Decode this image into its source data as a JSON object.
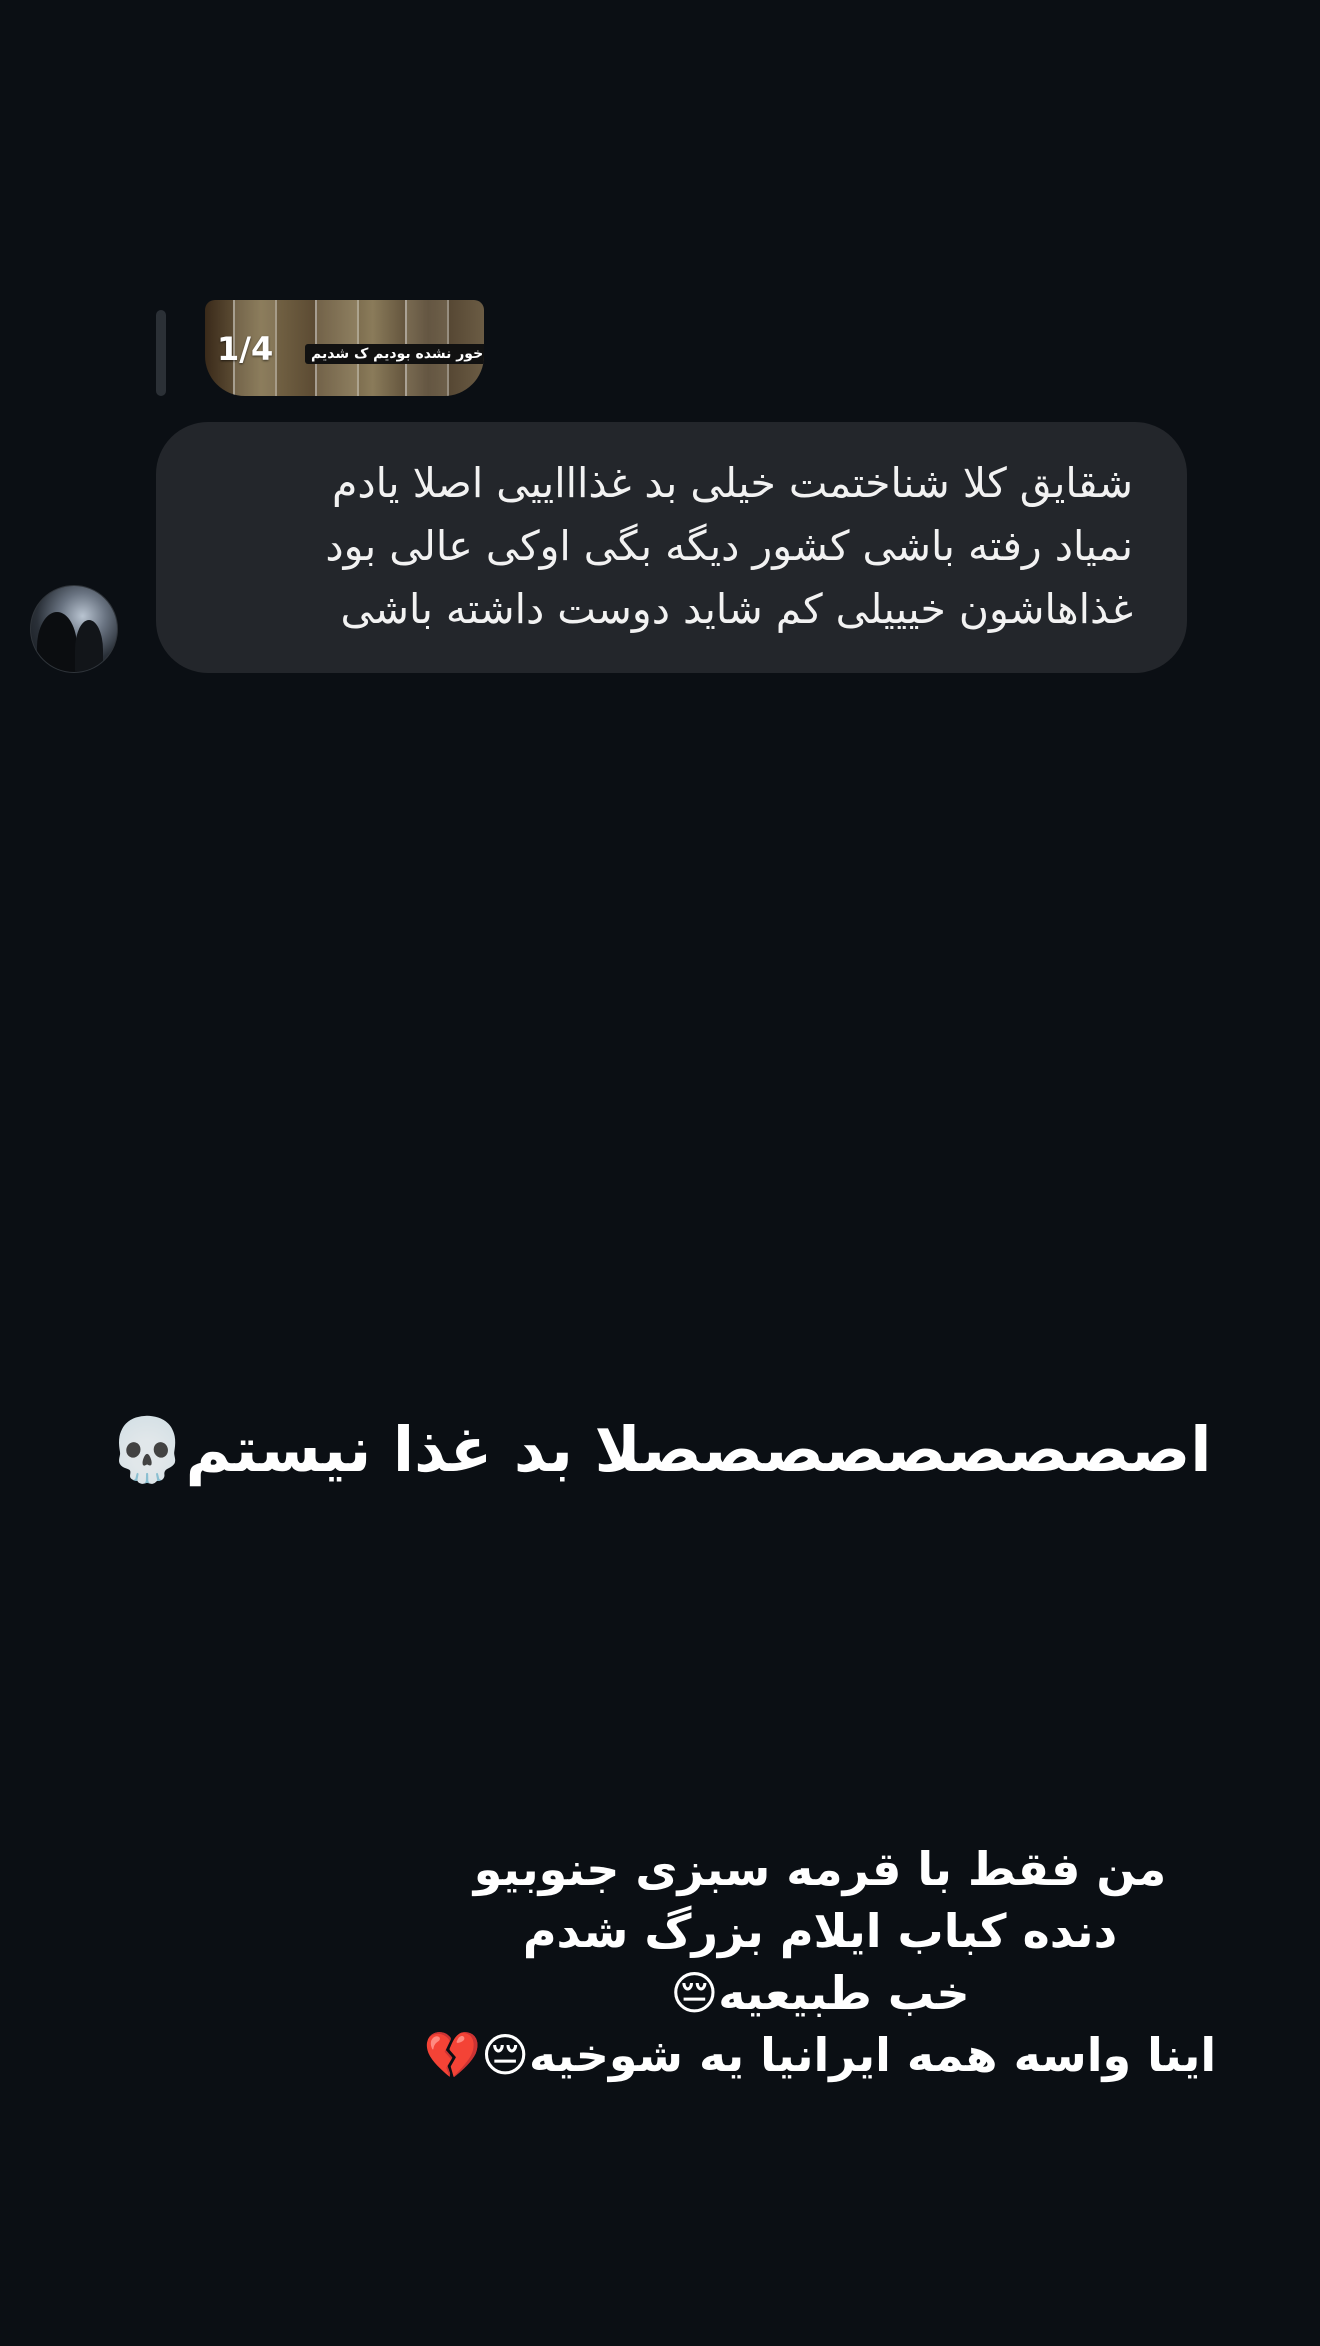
{
  "story_reply": {
    "counter": "1/4",
    "caption": "خور نشده بودیم ک شدیم"
  },
  "message": {
    "text": "شقایق کلا شناختمت خیلی بد غذاااییی اصلا یادم\nنمیاد رفته باشی کشور دیگه بگی اوکی عالی بود\nغذاهاشون خیییلی کم شاید دوست داشته باشی"
  },
  "overlay_text": {
    "line1": "اصصصصصصصصصلا بد غذا نیستم💀",
    "block": [
      "من فقط با قرمه سبزی جنوبیو",
      "دنده کباب ایلام بزرگ شدم",
      "خب طبیعیه😔",
      "اینا واسه همه ایرانیا یه شوخیه😔💔"
    ]
  }
}
